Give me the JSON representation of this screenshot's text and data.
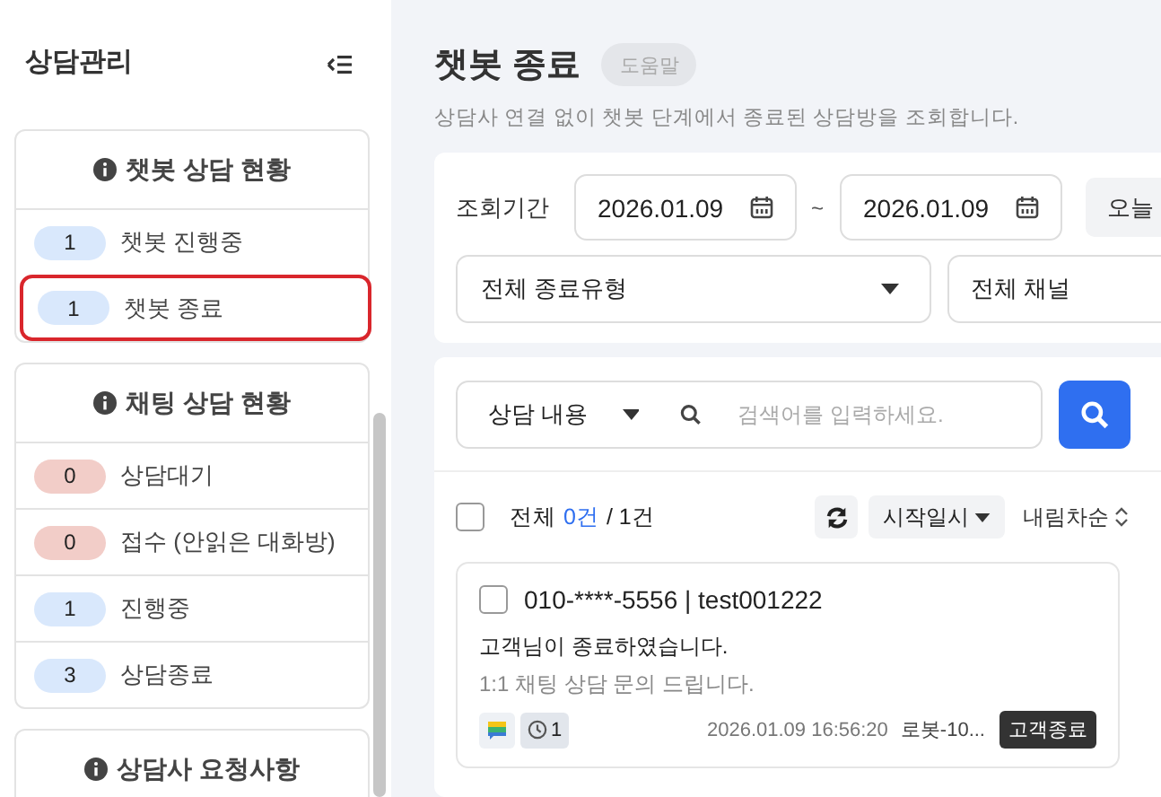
{
  "sidebar": {
    "title": "상담관리",
    "sections": [
      {
        "title": "챗봇 상담 현황",
        "items": [
          {
            "count": "1",
            "label": "챗봇 진행중",
            "color": "#d9e8fc",
            "selected": false
          },
          {
            "count": "1",
            "label": "챗봇 종료",
            "color": "#d9e8fc",
            "selected": true
          }
        ]
      },
      {
        "title": "채팅 상담 현황",
        "items": [
          {
            "count": "0",
            "label": "상담대기",
            "color": "#f2cdc8",
            "selected": false
          },
          {
            "count": "0",
            "label": "접수 (안읽은 대화방)",
            "color": "#f2cdc8",
            "selected": false
          },
          {
            "count": "1",
            "label": "진행중",
            "color": "#d9e8fc",
            "selected": false
          },
          {
            "count": "3",
            "label": "상담종료",
            "color": "#d9e8fc",
            "selected": false
          }
        ]
      },
      {
        "title": "상담사 요청사항"
      }
    ]
  },
  "page": {
    "title": "챗봇 종료",
    "help": "도움말",
    "description": "상담사 연결 없이 챗봇 단계에서 종료된 상담방을 조회합니다."
  },
  "filters": {
    "period_label": "조회기간",
    "date_from": "2026.01.09",
    "separator": "~",
    "date_to": "2026.01.09",
    "today_button": "오늘",
    "end_type": "전체 종료유형",
    "channel": "전체 채널"
  },
  "search": {
    "scope": "상담 내용",
    "placeholder": "검색어를 입력하세요."
  },
  "list_header": {
    "checked": false,
    "all_label": "전체",
    "selected_count": "0건",
    "total": "/ 1건",
    "sort_field": "시작일시",
    "sort_order": "내림차순"
  },
  "items": [
    {
      "checked": false,
      "title": "010-****-5556 | test001222",
      "status_message": "고객님이 종료하였습니다.",
      "preview": "1:1 채팅 상담 문의 드립니다.",
      "count": "1",
      "time": "2026.01.09 16:56:20",
      "agent": "로봇-10...",
      "tag": "고객종료"
    }
  ]
}
